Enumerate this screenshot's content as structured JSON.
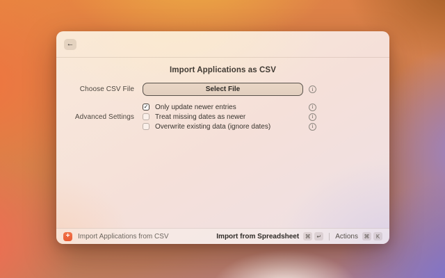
{
  "icons": {
    "back": "←",
    "plus": "+",
    "info": "i",
    "check": "✓"
  },
  "window": {
    "title": "Import Applications as CSV",
    "form": {
      "file_label": "Choose CSV File",
      "file_button": "Select File",
      "advanced_label": "Advanced Settings",
      "checkboxes": [
        {
          "label": "Only update newer entries",
          "checked": true
        },
        {
          "label": "Treat missing dates as newer",
          "checked": false
        },
        {
          "label": "Overwrite existing data (ignore dates)",
          "checked": false
        }
      ]
    },
    "footer": {
      "app_title": "Import Applications from CSV",
      "primary_action": "Import from Spreadsheet",
      "primary_keys": [
        "⌘",
        "↵"
      ],
      "actions_label": "Actions",
      "actions_keys": [
        "⌘",
        "K"
      ]
    }
  },
  "colors": {
    "accent_orange": "#ED6A3F",
    "window_cream": "#F7E5D9",
    "window_lavender": "#EEE1E6",
    "button_tan": "#E5D2C2",
    "button_border": "#57504A",
    "text_dark": "#3A3530",
    "text_muted": "#6E6760",
    "bg_orange": "#E98440",
    "bg_yellow": "#EEB244",
    "bg_purple": "#7B72CF"
  }
}
